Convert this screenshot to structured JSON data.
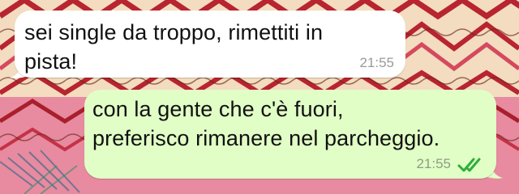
{
  "chat": {
    "messages": [
      {
        "direction": "incoming",
        "text": "sei single da troppo, rimettiti in\npista!",
        "time": "21:55"
      },
      {
        "direction": "outgoing",
        "text": "con la gente che c'è fuori,\npreferisco rimanere nel parcheggio.",
        "time": "21:55",
        "status_icon": "double-check-icon"
      }
    ]
  },
  "colors": {
    "incoming_bubble": "#ffffff",
    "outgoing_bubble": "#e1fec6",
    "check_color": "#2fae3a",
    "wallpaper_pink": "#e8748c",
    "wallpaper_red": "#b8242f",
    "wallpaper_cream": "#f6e6cf"
  }
}
